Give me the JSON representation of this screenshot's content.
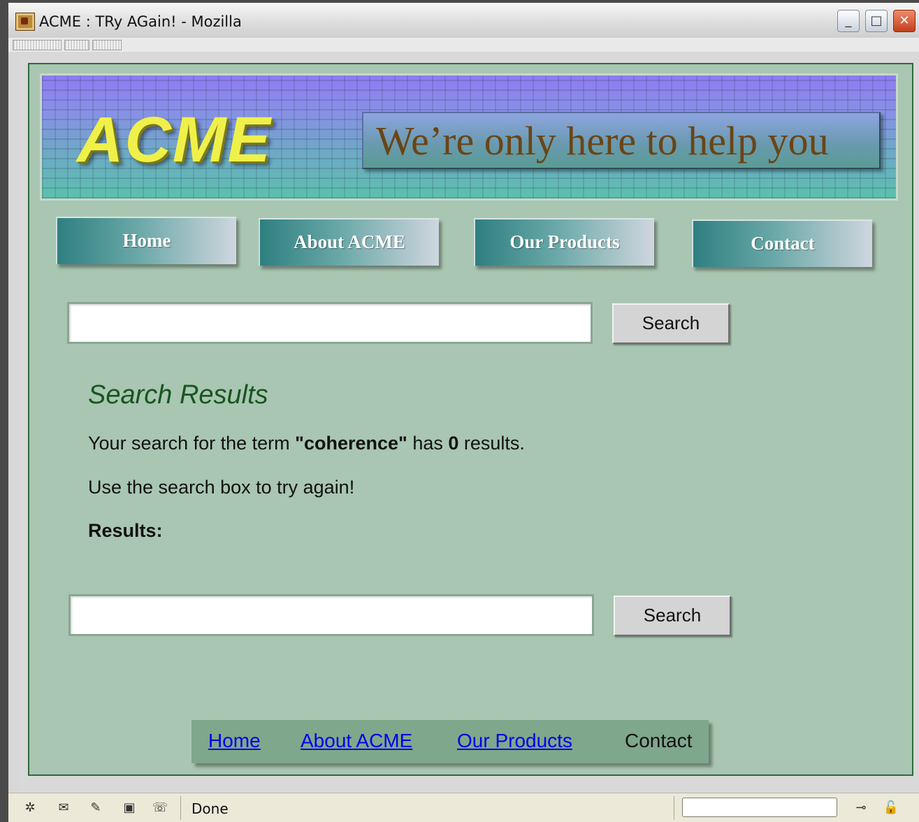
{
  "window": {
    "title": "ACME : TRy AGain! - Mozilla",
    "buttons": {
      "minimize": "_",
      "maximize": "□",
      "close": "✕"
    }
  },
  "banner": {
    "logo": "ACME",
    "tagline": "We’re only here to help you"
  },
  "nav": {
    "items": [
      {
        "label": "Home"
      },
      {
        "label": "About ACME"
      },
      {
        "label": "Our Products"
      },
      {
        "label": "Contact"
      }
    ]
  },
  "search_top": {
    "value": "",
    "placeholder": "",
    "button": "Search"
  },
  "results": {
    "heading": "Search Results",
    "line1_prefix": "Your search for the term ",
    "term": "\"coherence\"",
    "line1_mid": " has ",
    "count": "0",
    "line1_suffix": " results.",
    "line2": "Use the search box to try again!",
    "label": "Results:"
  },
  "search_bottom": {
    "value": "",
    "placeholder": "",
    "button": "Search"
  },
  "footer": {
    "links": [
      {
        "label": "Home "
      },
      {
        "label": "About ACME"
      },
      {
        "label": "Our Products"
      }
    ],
    "current": "Contact"
  },
  "statusbar": {
    "text": "Done",
    "icons": [
      "navigator-icon",
      "mail-icon",
      "composer-icon",
      "address-book-icon",
      "chatzilla-icon",
      "connection-icon",
      "security-lock-icon"
    ]
  },
  "colors": {
    "page_bg": "#a9c6b2",
    "heading": "#17551f",
    "link": "#0000ee",
    "logo": "#f0f04a",
    "tagline": "#6a4516"
  }
}
